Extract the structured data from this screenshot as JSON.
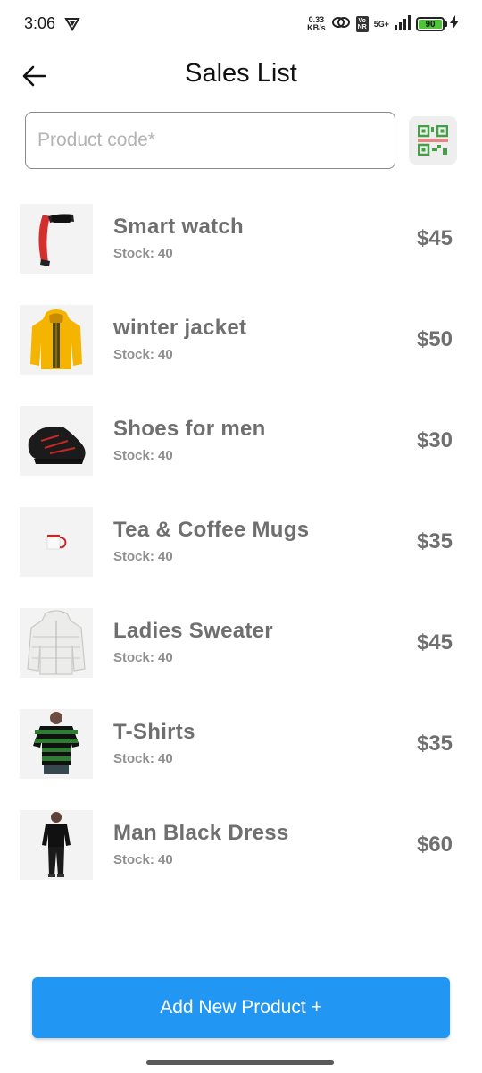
{
  "status_bar": {
    "time": "3:06",
    "net_speed_value": "0.33",
    "net_speed_unit": "KB/s",
    "volte_top": "Vo",
    "volte_bottom": "NR",
    "network_type": "5G+",
    "battery_level": "90",
    "battery_color": "#4cc636",
    "icons": [
      "shield-icon",
      "link-icon",
      "signal-icon",
      "battery-icon",
      "charging-icon"
    ]
  },
  "header": {
    "title": "Sales List",
    "back_icon": "arrow-left-icon"
  },
  "search": {
    "placeholder": "Product code*",
    "value": "",
    "scan_icon": "qr-code-icon"
  },
  "products": [
    {
      "name": "Smart watch",
      "stock": "Stock: 40",
      "price": "$45",
      "icon": "smart-watch-image"
    },
    {
      "name": "winter jacket",
      "stock": "Stock: 40",
      "price": "$50",
      "icon": "yellow-jacket-image"
    },
    {
      "name": "Shoes for men",
      "stock": "Stock: 40",
      "price": "$30",
      "icon": "black-shoe-image"
    },
    {
      "name": "Tea & Coffee Mugs",
      "stock": "Stock: 40",
      "price": "$35",
      "icon": "mug-image"
    },
    {
      "name": "Ladies Sweater",
      "stock": "Stock: 40",
      "price": "$45",
      "icon": "white-puffer-image"
    },
    {
      "name": "T-Shirts",
      "stock": "Stock: 40",
      "price": "$35",
      "icon": "striped-tshirt-image"
    },
    {
      "name": "Man Black Dress",
      "stock": "Stock: 40",
      "price": "$60",
      "icon": "black-outfit-image"
    }
  ],
  "footer": {
    "add_button_label": "Add New Product +",
    "accent_color": "#2196f3"
  }
}
